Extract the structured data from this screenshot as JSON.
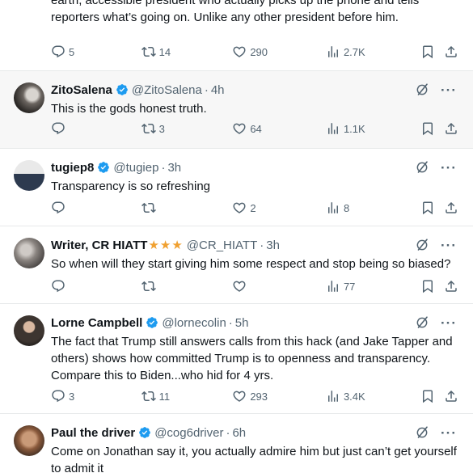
{
  "posts": [
    {
      "text": "earth, accessible president who actually picks up the phone and tells reporters what’s going on. Unlike any other president before him.",
      "replies": "5",
      "reposts": "14",
      "likes": "290",
      "views": "2.7K"
    },
    {
      "name": "ZitoSalena",
      "handle": "@ZitoSalena",
      "time": "4h",
      "text": "This is the gods honest truth.",
      "replies": "",
      "reposts": "3",
      "likes": "64",
      "views": "1.1K"
    },
    {
      "name": "tugiep8",
      "handle": "@tugiep",
      "time": "3h",
      "text": "Transparency is so refreshing",
      "replies": "",
      "reposts": "",
      "likes": "2",
      "views": "8"
    },
    {
      "name": "Writer, CR HIATT",
      "stars": "★★★",
      "handle": "@CR_HIATT",
      "time": "3h",
      "text": "So when will they start giving him some respect and stop being so biased?",
      "replies": "",
      "reposts": "",
      "likes": "",
      "views": "77"
    },
    {
      "name": "Lorne Campbell",
      "handle": "@lornecolin",
      "time": "5h",
      "text": "The fact that Trump still answers calls from this hack (and Jake Tapper and others) shows how committed Trump is to openness and transparency. Compare this to Biden...who hid for 4 yrs.",
      "replies": "3",
      "reposts": "11",
      "likes": "293",
      "views": "3.4K"
    },
    {
      "name": "Paul the driver",
      "handle": "@cog6driver",
      "time": "6h",
      "text": "Come on Jonathan say it, you actually admire him but just can’t get yourself to admit it"
    }
  ],
  "separator": "·",
  "more_glyph": "···",
  "icons": {
    "reply": "reply-icon",
    "repost": "repost-icon",
    "like": "like-icon",
    "views": "views-icon",
    "bookmark": "bookmark-icon",
    "share": "share-icon",
    "grok": "grok-icon",
    "verified": "verified-badge-icon",
    "more": "more-icon"
  },
  "colors": {
    "text": "#0f1419",
    "muted": "#536471",
    "verified": "#1d9bf0",
    "stars": "#f0a030",
    "highlight": "#f7f7f7"
  }
}
